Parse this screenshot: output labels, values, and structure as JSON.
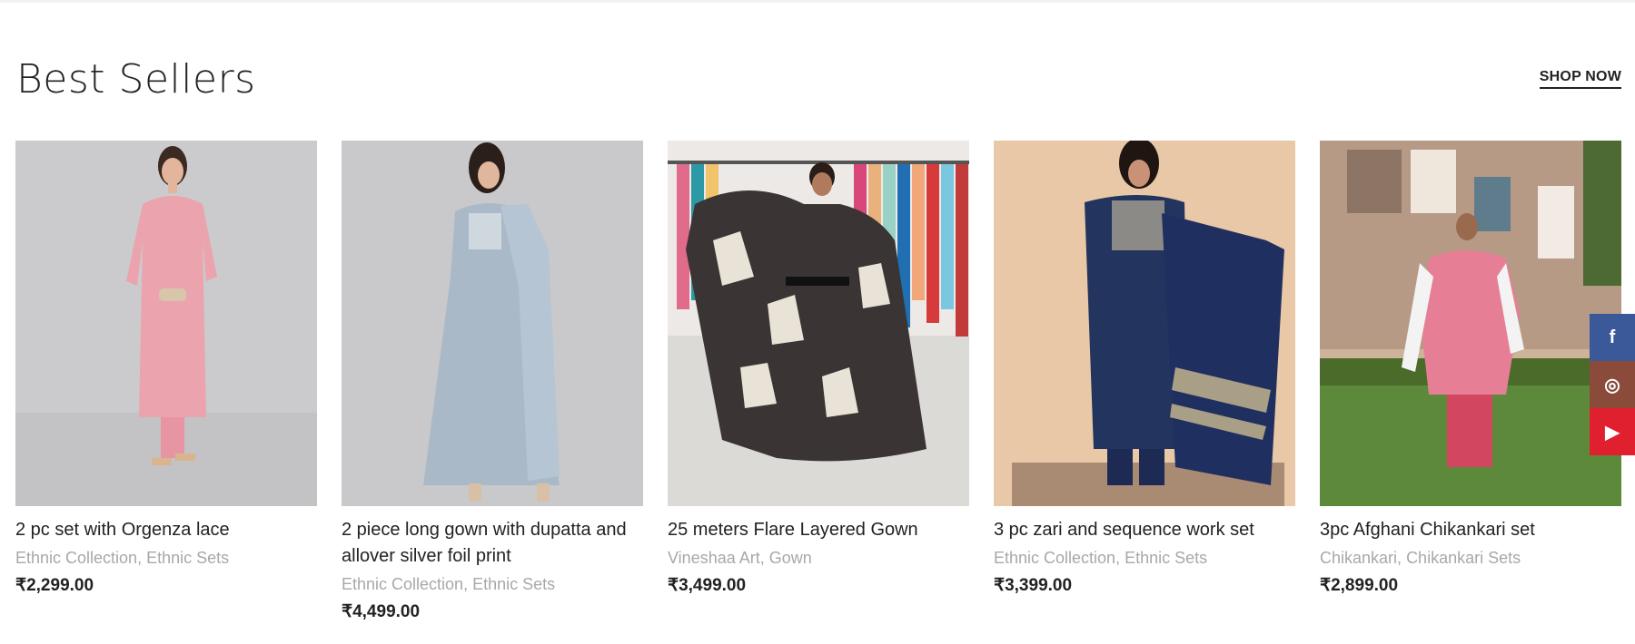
{
  "section": {
    "title": "Best Sellers",
    "cta": "SHOP NOW"
  },
  "products": [
    {
      "title": "2 pc set with Orgenza lace",
      "categories": [
        "Ethnic Collection",
        "Ethnic Sets"
      ],
      "price": "₹2,299.00",
      "image": "pink-kurta-set-photo"
    },
    {
      "title": "2 piece long gown with dupatta and allover silver foil print",
      "categories": [
        "Ethnic Collection",
        "Ethnic Sets"
      ],
      "price": "₹4,499.00",
      "image": "light-blue-gown-photo"
    },
    {
      "title": "25 meters Flare Layered Gown",
      "categories": [
        "Vineshaa Art",
        "Gown"
      ],
      "price": "₹3,499.00",
      "image": "printed-flare-gown-photo"
    },
    {
      "title": "3 pc zari and sequence work set",
      "categories": [
        "Ethnic Collection",
        "Ethnic Sets"
      ],
      "price": "₹3,399.00",
      "image": "navy-zari-set-photo"
    },
    {
      "title": "3pc Afghani Chikankari set",
      "categories": [
        "Chikankari",
        "Chikankari Sets"
      ],
      "price": "₹2,899.00",
      "image": "pink-chikankari-set-photo"
    }
  ],
  "social": [
    {
      "icon": "facebook-icon",
      "glyph": "f",
      "color": "#3b5998"
    },
    {
      "icon": "instagram-icon",
      "glyph": "◎",
      "color": "#8a4b3a"
    },
    {
      "icon": "youtube-icon",
      "glyph": "▶",
      "color": "#e0202f"
    }
  ],
  "separator": ", "
}
